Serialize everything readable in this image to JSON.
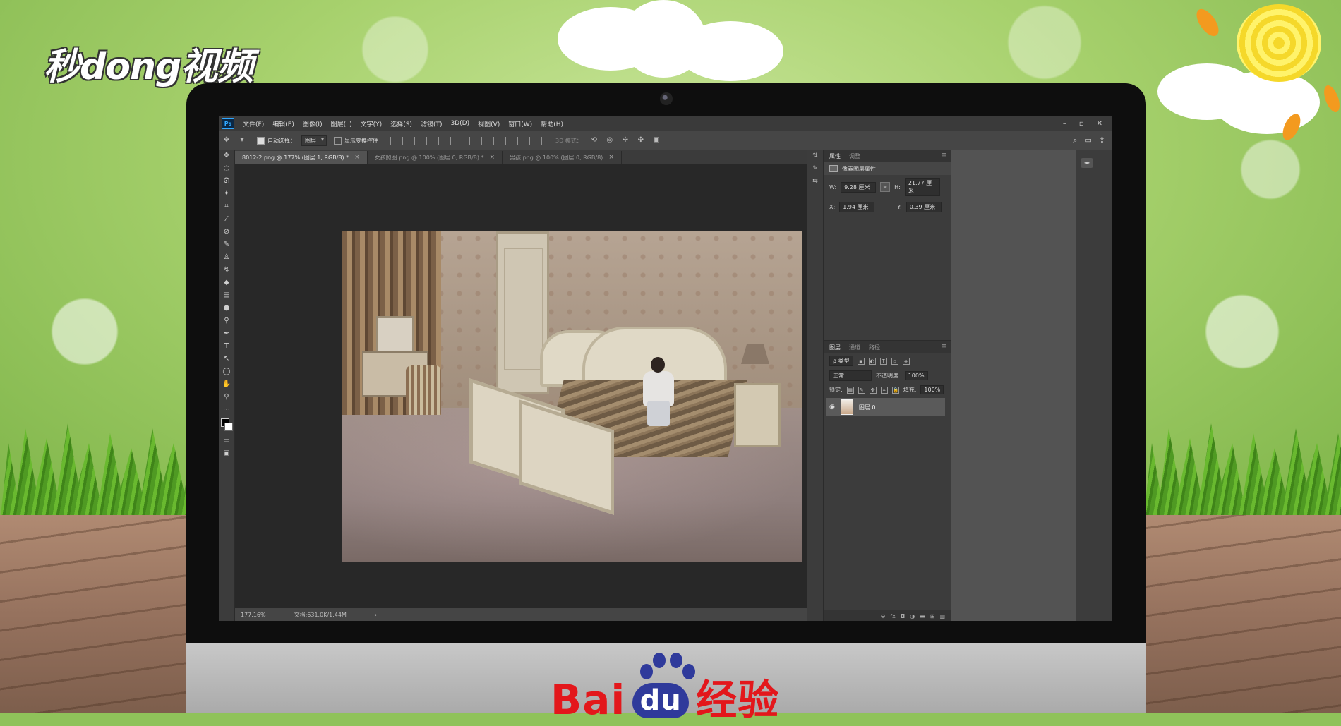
{
  "watermark": {
    "brand": "秒dong视频",
    "footer_brand": "Bai",
    "footer_du": "du",
    "footer_suffix": "经验"
  },
  "app": {
    "badge": "Ps",
    "menu": [
      "文件(F)",
      "编辑(E)",
      "图像(I)",
      "图层(L)",
      "文字(Y)",
      "选择(S)",
      "滤镜(T)",
      "3D(D)",
      "视图(V)",
      "窗口(W)",
      "帮助(H)"
    ],
    "window_controls": [
      "–",
      "▫",
      "✕"
    ]
  },
  "options_bar": {
    "auto_select_label": "自动选择：",
    "auto_select_value": "图层",
    "auto_select_checked": true,
    "show_transform_label": "显示变换控件",
    "show_transform_checked": false,
    "mode_3d_label": "3D 模式：",
    "right_icons": [
      "search-icon",
      "workspace-icon",
      "share-icon"
    ]
  },
  "tabs": [
    {
      "label": "8012-2.png @ 177% (图层 1, RGB/8) *",
      "active": true
    },
    {
      "label": "女孩照图.png @ 100% (图层 0, RGB/8) *",
      "active": false
    },
    {
      "label": "男孩.png @ 100% (图层 0, RGB/8)",
      "active": false
    }
  ],
  "status": {
    "zoom": "177.16%",
    "doc": "文档:631.0K/1.44M"
  },
  "properties_panel": {
    "tabs": [
      "属性",
      "调整"
    ],
    "title": "像素图层属性",
    "w_label": "W:",
    "w_value": "9.28 厘米",
    "h_label": "H:",
    "h_value": "21.77 厘米",
    "x_label": "X:",
    "x_value": "1.94 厘米",
    "y_label": "Y:",
    "y_value": "0.39 厘米",
    "link_glyph": "∞"
  },
  "layers_panel": {
    "tabs": [
      "图层",
      "通道",
      "路径"
    ],
    "kind_label": "ρ 类型",
    "blend_mode": "正常",
    "opacity_label": "不透明度:",
    "opacity_value": "100%",
    "lock_label": "锁定:",
    "fill_label": "填充:",
    "fill_value": "100%",
    "layers": [
      {
        "name": "图层 0",
        "visible": true
      }
    ]
  },
  "colors": {
    "ps_bg": "#535353",
    "panel": "#3c3c3c",
    "canvas": "#282828",
    "baidu_red": "#e3171b",
    "baidu_blue": "#2f3a9b"
  }
}
